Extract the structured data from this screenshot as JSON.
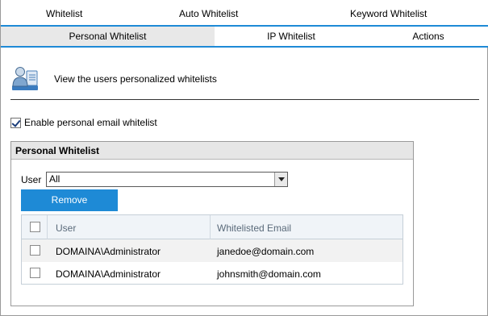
{
  "tabs_row1": [
    {
      "label": "Whitelist"
    },
    {
      "label": "Auto Whitelist"
    },
    {
      "label": "Keyword Whitelist"
    }
  ],
  "tabs_row2": [
    {
      "label": "Personal Whitelist",
      "active": true
    },
    {
      "label": "IP Whitelist",
      "active": false
    },
    {
      "label": "Actions",
      "active": false
    }
  ],
  "header": {
    "icon": "user-list-icon",
    "description": "View the users personalized whitelists"
  },
  "enable": {
    "label": "Enable personal email whitelist",
    "checked": true
  },
  "panel": {
    "title": "Personal Whitelist",
    "user_label": "User",
    "user_selected": "All",
    "remove_label": "Remove",
    "columns": {
      "user": "User",
      "email": "Whitelisted Email"
    },
    "rows": [
      {
        "user": "DOMAINA\\Administrator",
        "email": "janedoe@domain.com",
        "checked": false
      },
      {
        "user": "DOMAINA\\Administrator",
        "email": "johnsmith@domain.com",
        "checked": false
      }
    ]
  },
  "colors": {
    "accent": "#1e8ad6",
    "tab_active_bg": "#e8e8e8",
    "panel_header_bg": "#e6e6e6"
  }
}
